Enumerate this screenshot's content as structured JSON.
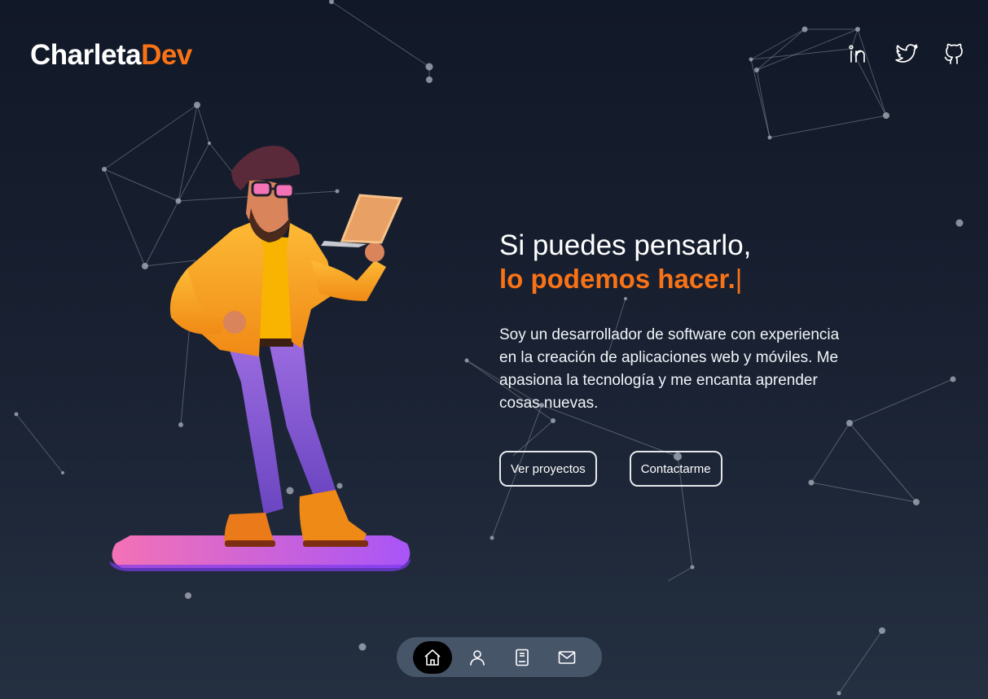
{
  "header": {
    "logo_main": "Charleta",
    "logo_accent": "Dev",
    "social": [
      {
        "icon": "linkedin-icon"
      },
      {
        "icon": "twitter-icon"
      },
      {
        "icon": "github-icon"
      }
    ]
  },
  "hero": {
    "title_line1": "Si puedes pensarlo,",
    "title_line2": "lo podemos hacer.",
    "cursor": "|",
    "description": "Soy un desarrollador de software con experiencia en la creación de aplicaciones web y móviles. Me apasiona la tecnología y me encanta aprender cosas nuevas.",
    "buttons": {
      "projects_label": "Ver proyectos",
      "contact_label": "Contactarme"
    }
  },
  "dock": {
    "items": [
      {
        "icon": "home-icon",
        "active": true
      },
      {
        "icon": "user-icon",
        "active": false
      },
      {
        "icon": "book-icon",
        "active": false
      },
      {
        "icon": "mail-icon",
        "active": false
      }
    ]
  },
  "colors": {
    "accent": "#f97316",
    "background_top": "#111827",
    "background_bottom": "#243041",
    "dock": "#475569"
  }
}
